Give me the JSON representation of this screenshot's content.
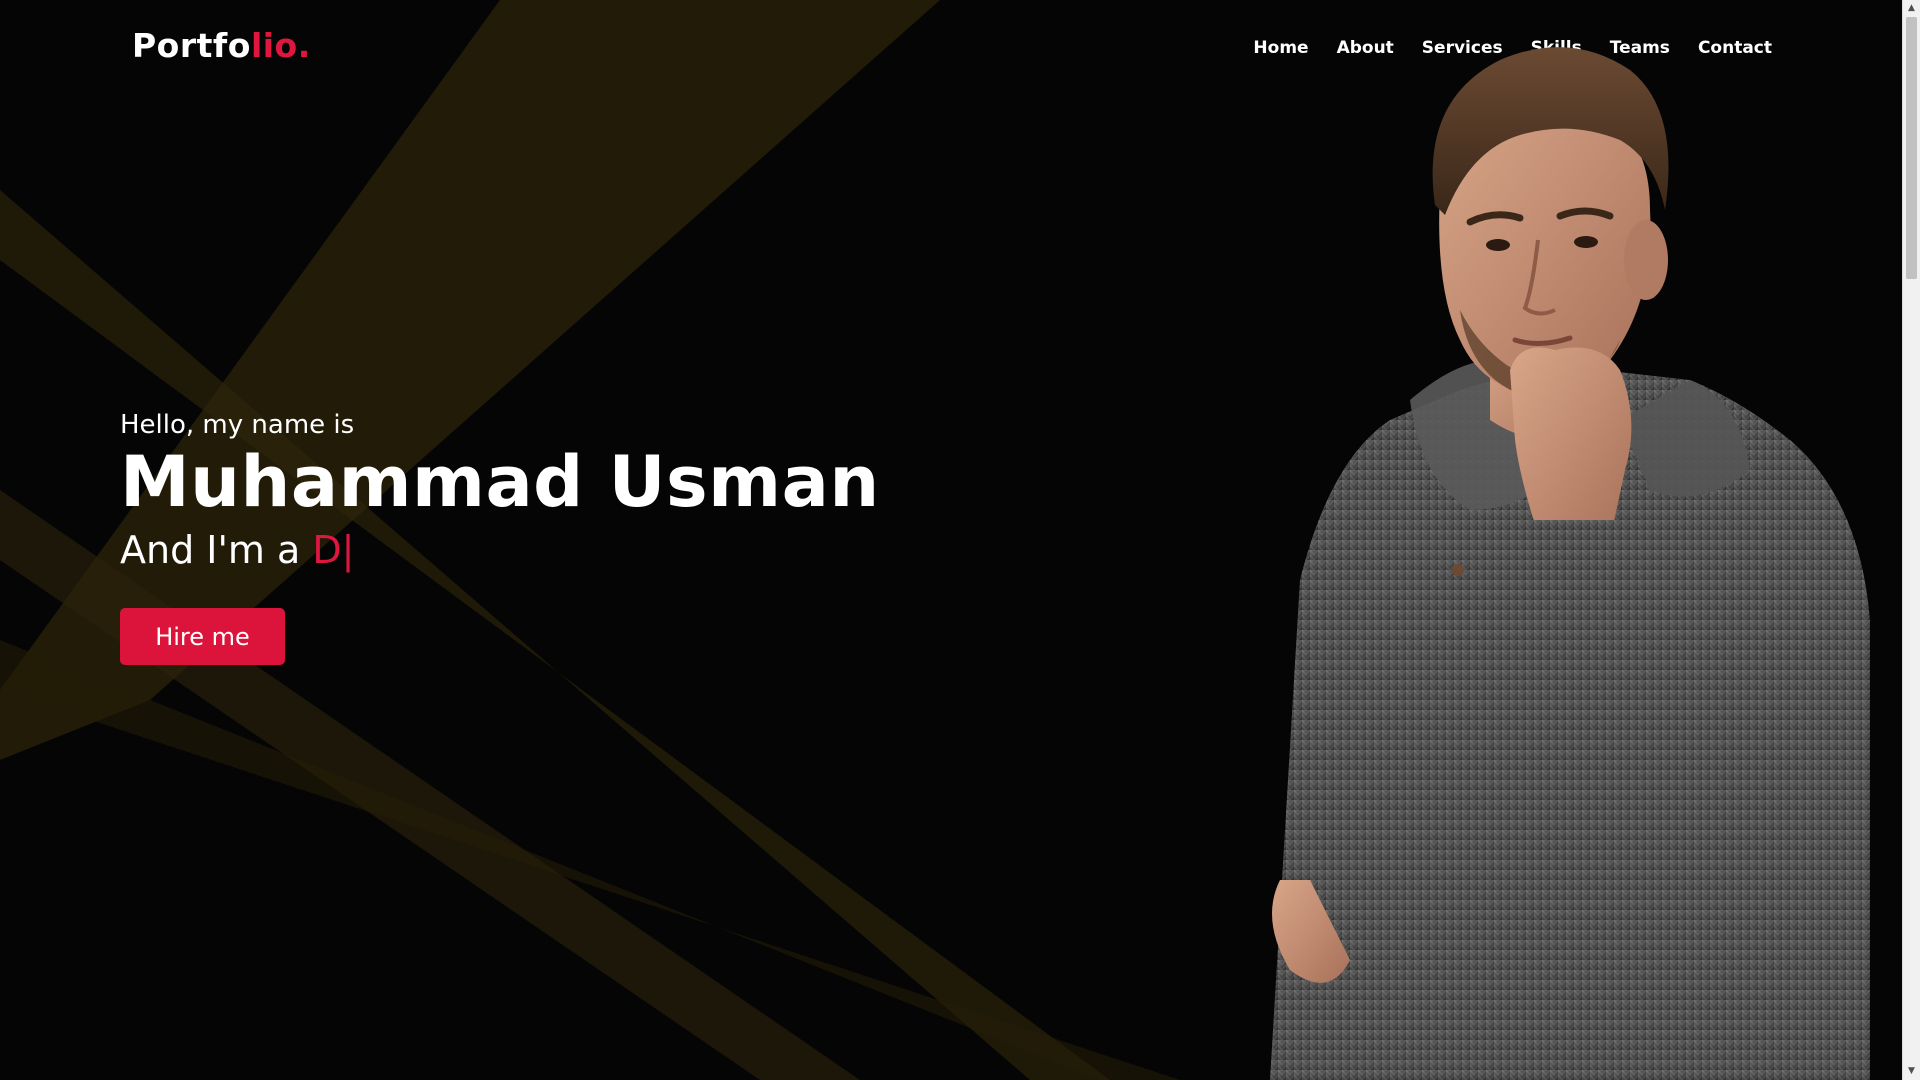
{
  "logo": {
    "main": "Portfo",
    "accent": "lio."
  },
  "nav": {
    "items": [
      "Home",
      "About",
      "Services",
      "Skills",
      "Teams",
      "Contact"
    ]
  },
  "hero": {
    "greeting": "Hello, my name is",
    "name": "Muhammad Usman",
    "role_prefix": "And I'm a ",
    "role_typed": "D|",
    "hire_button": "Hire me"
  },
  "colors": {
    "background": "#050505",
    "accent": "#dc143c",
    "text": "#ffffff",
    "rays": "#3a2f0c"
  },
  "icons": {
    "scroll_up": "triangle-up",
    "scroll_down": "triangle-down"
  }
}
